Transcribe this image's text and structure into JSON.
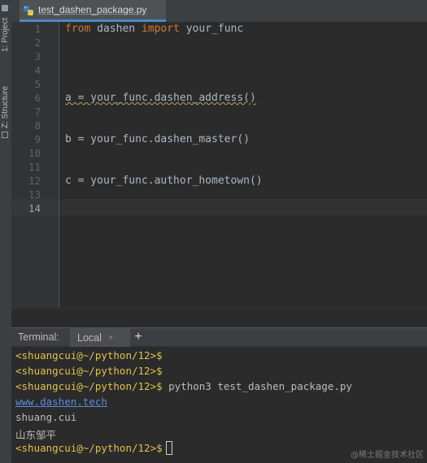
{
  "sidebar": {
    "project_tab": "1: Project",
    "structure_tab": "Z: Structure"
  },
  "editor": {
    "tab_label": "test_dashen_package.py",
    "line_numbers": [
      "1",
      "2",
      "3",
      "4",
      "5",
      "6",
      "7",
      "8",
      "9",
      "10",
      "11",
      "12",
      "13",
      "14"
    ],
    "line1": {
      "kw1": "from",
      "t1": " dashen ",
      "kw2": "import",
      "t2": " your_func"
    },
    "line6": "a = your_func.dashen_address()",
    "line9": "b = your_func.dashen_master()",
    "line12": "c = your_func.author_hometown()",
    "current_line": "14"
  },
  "terminal": {
    "title": "Terminal:",
    "local_tab": "Local",
    "close_glyph": "×",
    "add_glyph": "+",
    "lines": [
      {
        "prompt": "<shuangcui@~/python/12>$",
        "text": ""
      },
      {
        "prompt": "<shuangcui@~/python/12>$",
        "text": ""
      },
      {
        "prompt": "<shuangcui@~/python/12>$",
        "text": " python3 test_dashen_package.py"
      }
    ],
    "link_output": "www.dashen.tech",
    "output2": "shuang.cui",
    "output3": "山东邹平",
    "last_prompt": "<shuangcui@~/python/12>$"
  },
  "watermark": "@稀土掘金技术社区",
  "colors": {
    "keyword": "#cc7832",
    "prompt": "#e0c14f",
    "link": "#5c8cdd",
    "tab_accent": "#4a88c7"
  }
}
